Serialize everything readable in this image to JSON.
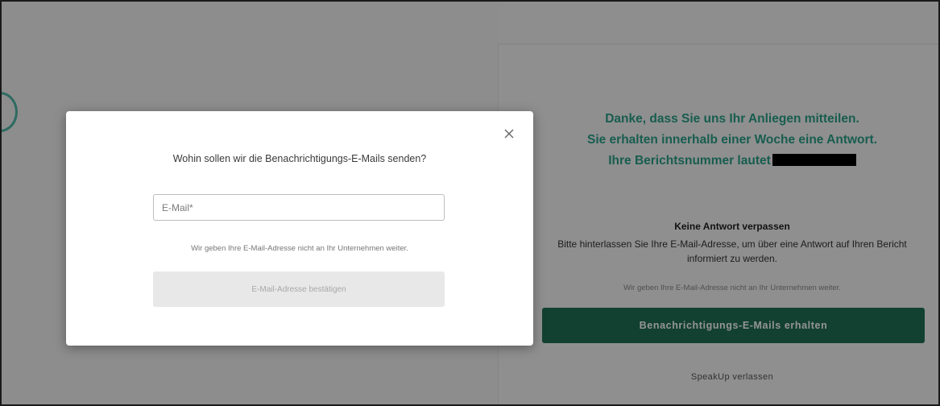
{
  "background": {
    "confirmation": {
      "line1": "Danke, dass Sie uns Ihr Anliegen mitteilen.",
      "line2": "Sie erhalten innerhalb einer Woche eine Antwort.",
      "line3": "Ihre Berichtsnummer lautet"
    },
    "notify_section": {
      "title": "Keine Antwort verpassen",
      "body": "Bitte hinterlassen Sie Ihre E-Mail-Adresse, um über eine Antwort auf Ihren Bericht informiert zu werden.",
      "privacy_note": "Wir geben Ihre E-Mail-Adresse nicht an Ihr Unternehmen weiter.",
      "cta_label": "Benachrichtigungs-E-Mails erhalten"
    },
    "leave_link": "SpeakUp verlassen"
  },
  "modal": {
    "question": "Wohin sollen wir die Benachrichtigungs-E-Mails senden?",
    "email_placeholder": "E-Mail*",
    "email_value": "",
    "privacy_note": "Wir geben Ihre E-Mail-Adresse nicht an Ihr Unternehmen weiter.",
    "confirm_label": "E-Mail-Adresse bestätigen",
    "close_icon": "close-icon"
  },
  "colors": {
    "accent_teal": "#2aa089",
    "cta_green": "#1f6e55",
    "disabled_button": "#e8e8e8"
  }
}
